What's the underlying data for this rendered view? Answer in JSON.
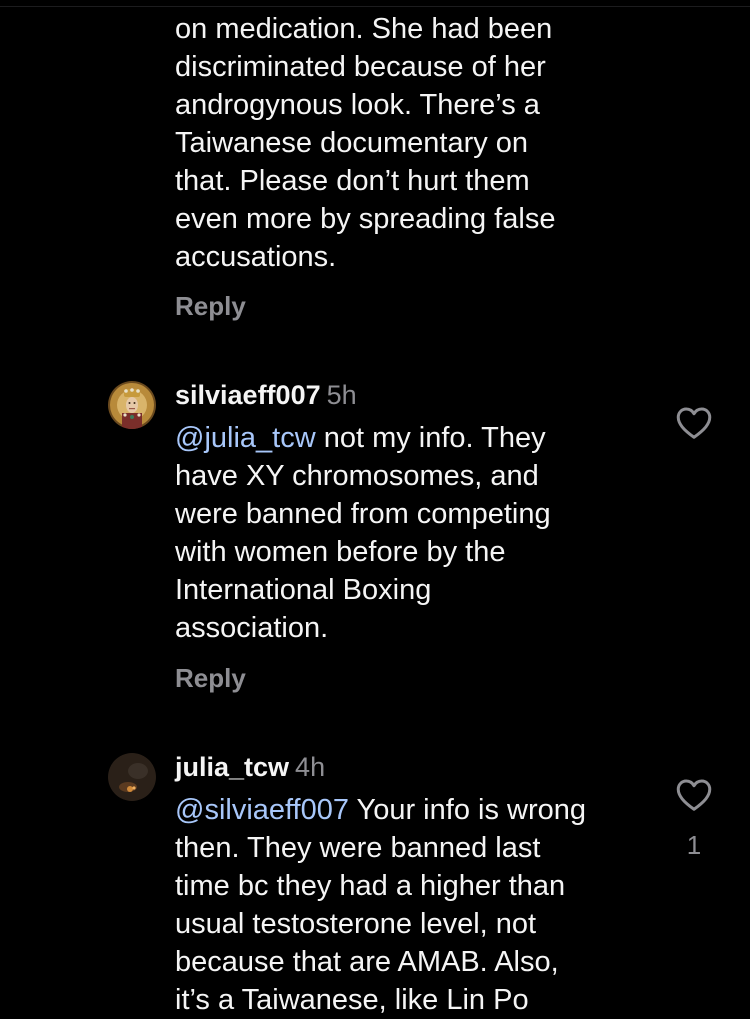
{
  "comments": [
    {
      "text": "on medication. She had been\ndiscriminated because of her\nandrogynous look. There’s a\nTaiwanese documentary on\nthat. Please don’t hurt them\neven more by spreading false\naccusations.",
      "reply_label": "Reply"
    },
    {
      "username": "silviaeff007",
      "time": "5h",
      "mention": "@julia_tcw",
      "text": " not my info. They\nhave XY chromosomes, and\nwere banned from competing\nwith women before by the\nInternational Boxing\nassociation.",
      "reply_label": "Reply",
      "avatar_icon": "byzantine-portrait-avatar",
      "like_icon": "heart-outline-icon"
    },
    {
      "username": "julia_tcw",
      "time": "4h",
      "mention": "@silviaeff007",
      "text": " Your info is wrong\nthen. They were banned last\ntime bc they had a higher than\nusual testosterone level, not\nbecause that are AMAB. Also,\nit’s a Taiwanese, like Lin Po",
      "like_count": "1",
      "avatar_icon": "dark-photo-avatar",
      "like_icon": "heart-outline-icon"
    }
  ],
  "colors": {
    "background": "#000000",
    "text": "#f5f5f5",
    "secondary": "#8e8e93",
    "mention": "#a8c7fa"
  }
}
